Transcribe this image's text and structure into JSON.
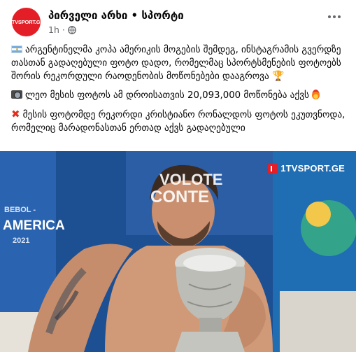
{
  "page": {
    "name": "პირველი არხი • სპორტი",
    "avatar_text": "1TVSPORT.GE",
    "time": "1h",
    "dot": "·"
  },
  "post": {
    "p1": "არგენტინელმა კოპა ამერიკის მოგების შემდეგ, ინსტაგრამის გვერდზე თასთან გადაღებული ფოტო დადო, რომელმაც სპორტსმენების ფოტოებს შორის რეკორდული რაოდენობის მოწონებები დააგროვა",
    "p2": "ლეო მესის ფოტოს ამ დროისათვის 20,093,000 მოწონება აქვს",
    "p3": "მესის ფოტომდე რეკორდი კრისტიანო რონალდოს ფოტოს ეკუთვნოდა, რომელიც მარადონასთან ერთად აქვს გადაღებული",
    "trophy_glyph": "🏆",
    "cross_glyph": "✖"
  },
  "photo": {
    "watermark": "1TVSPORT.GE",
    "bg_left_1": "BEBOL -",
    "bg_left_2": "AMERICA",
    "bg_left_3": "2021",
    "bg_center_1": "VOLOTE",
    "bg_center_2": "CONTE"
  },
  "icons": {
    "avatar": "channel-logo",
    "privacy": "globe-icon",
    "more": "more-options-icon",
    "flag": "argentina-flag-icon",
    "camera": "camera-icon",
    "fire": "fire-icon",
    "cross": "cross-mark-icon",
    "trophy": "trophy-icon"
  },
  "colors": {
    "brand_red": "#e41e26",
    "text": "#050505",
    "secondary_text": "#65676b"
  }
}
